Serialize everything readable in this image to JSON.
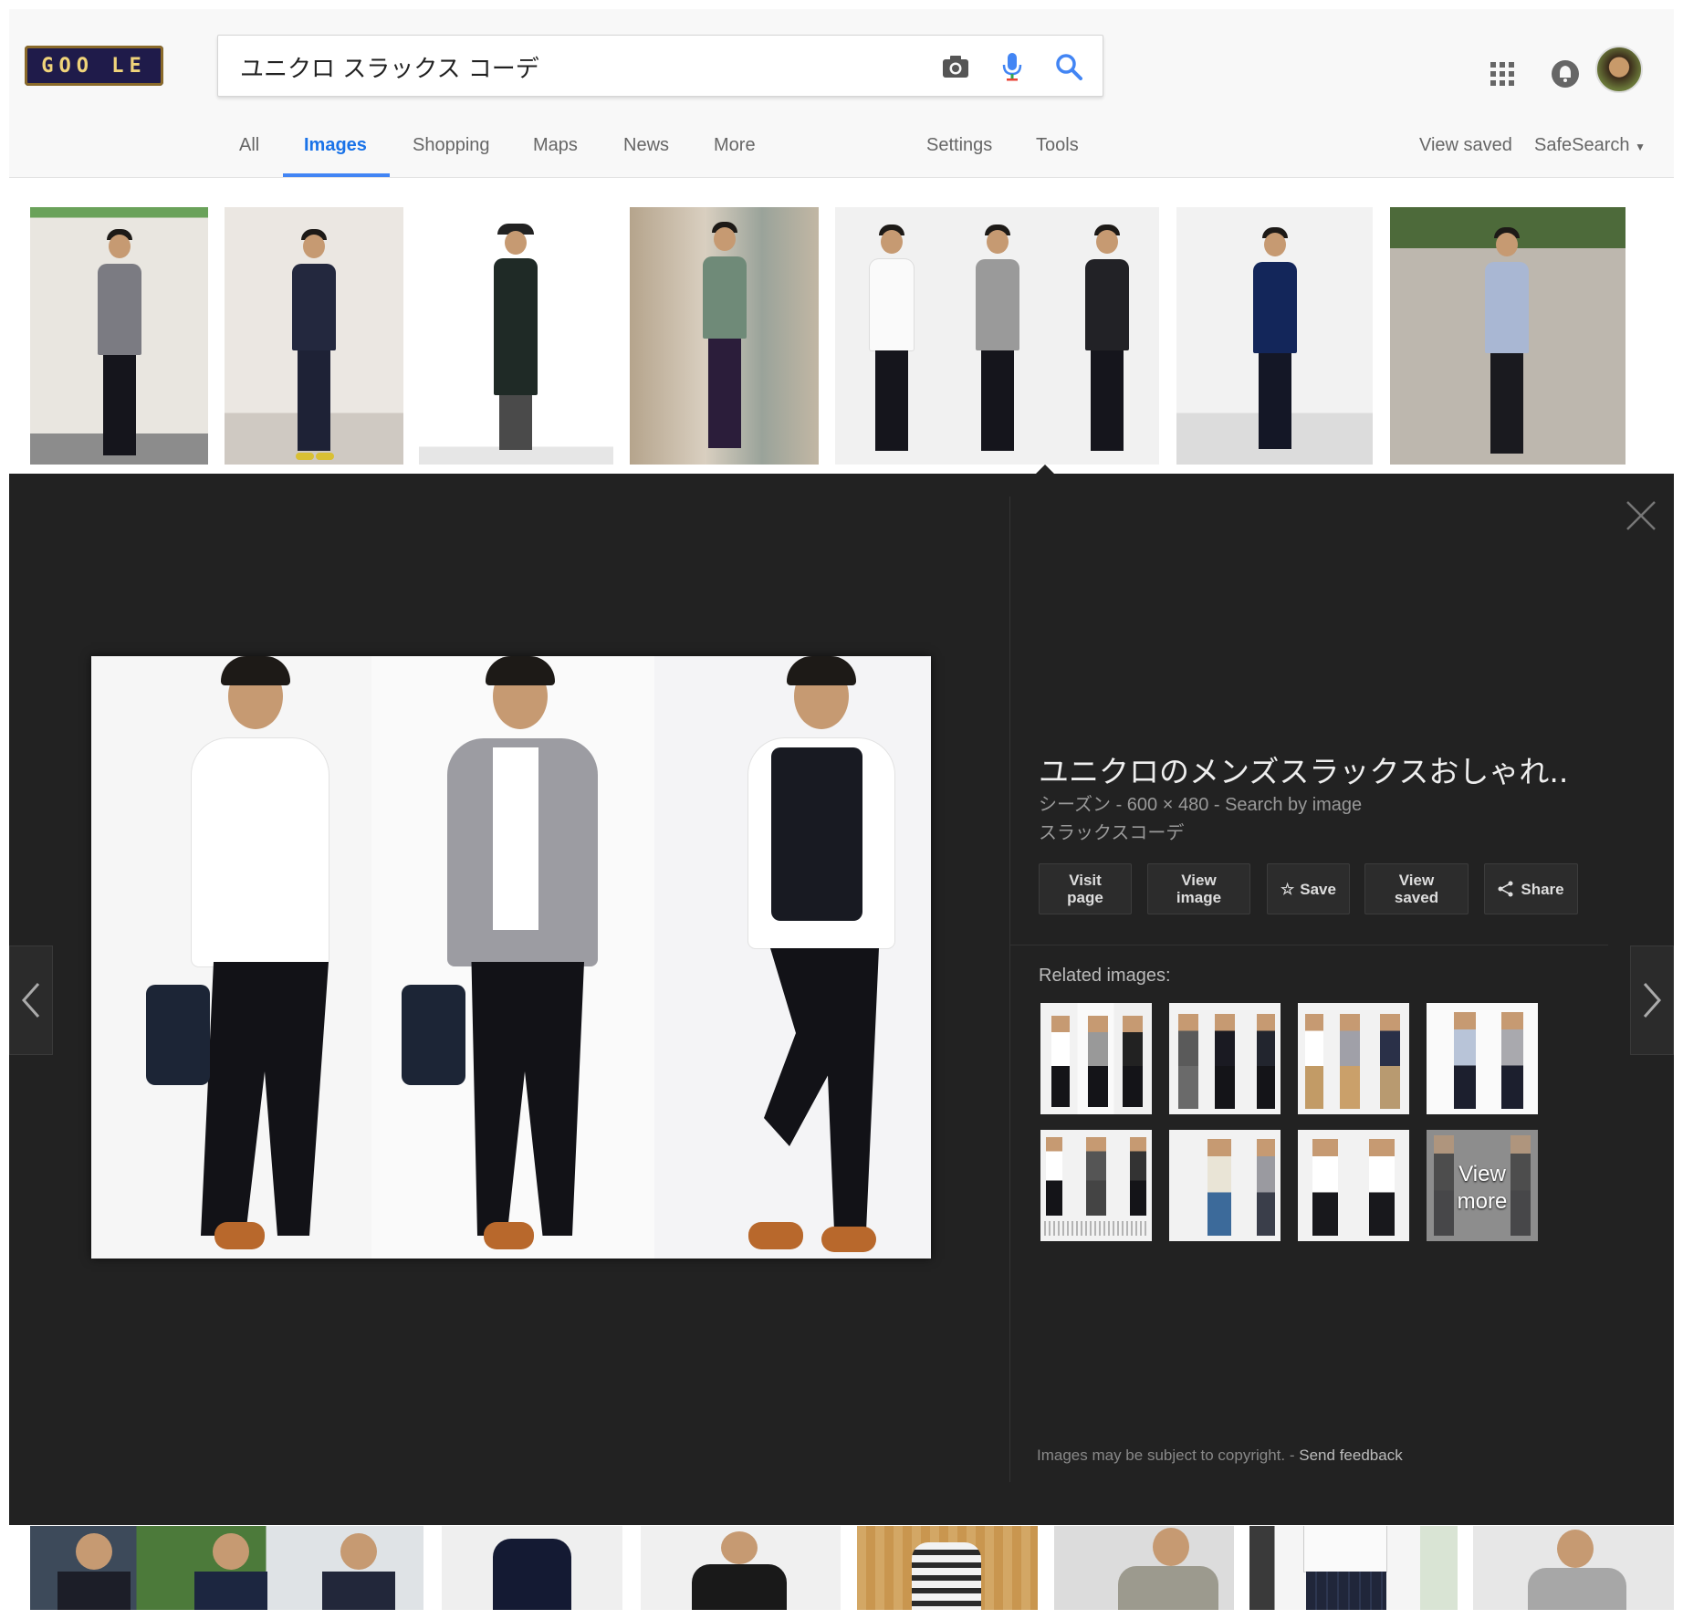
{
  "header": {
    "logo_text": "GOO LE",
    "search_query": "ユニクロ スラックス コーデ",
    "colors": {
      "accent": "#4285f4",
      "mic": "#4285f4",
      "header_bg": "#f8f8f8"
    },
    "icons": [
      "camera-icon",
      "microphone-icon",
      "search-icon",
      "apps-grid-icon",
      "notifications-bell-icon"
    ]
  },
  "tabs": {
    "all": "All",
    "images": "Images",
    "shopping": "Shopping",
    "maps": "Maps",
    "news": "News",
    "more": "More",
    "settings": "Settings",
    "tools": "Tools",
    "view_saved": "View saved",
    "safesearch": "SafeSearch"
  },
  "viewer": {
    "title": "ユニクロのメンズスラックスおしゃれ..",
    "source": "シーズン",
    "dimensions": "600 × 480",
    "search_by_image": "Search by image",
    "subtitle": "スラックスコーデ",
    "buttons": {
      "visit_page": "Visit\npage",
      "view_image": "View\nimage",
      "save": "Save",
      "view_saved": "View\nsaved",
      "share": "Share"
    },
    "related_label": "Related images:",
    "view_more": "View\nmore",
    "copyright": "Images may be subject to copyright.",
    "send_feedback": "Send feedback",
    "colors": {
      "panel_bg": "#222222",
      "title": "#eeeeee",
      "meta": "#999999"
    }
  }
}
